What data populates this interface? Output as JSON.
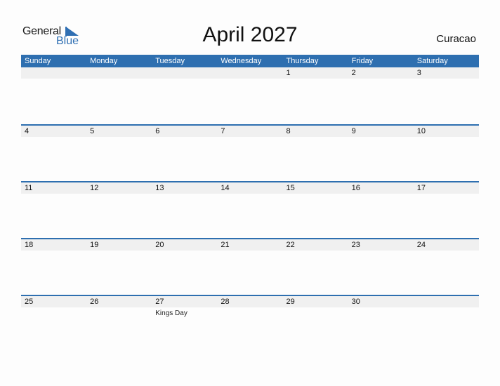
{
  "logo": {
    "line1": "General",
    "line2": "Blue"
  },
  "title": "April 2027",
  "country": "Curacao",
  "colors": {
    "accent": "#2e6fb0",
    "band": "#f0f0f0"
  },
  "weekdays": [
    "Sunday",
    "Monday",
    "Tuesday",
    "Wednesday",
    "Thursday",
    "Friday",
    "Saturday"
  ],
  "weeks": [
    {
      "days": [
        "",
        "",
        "",
        "",
        "1",
        "2",
        "3"
      ],
      "holidays": [
        "",
        "",
        "",
        "",
        "",
        "",
        ""
      ]
    },
    {
      "days": [
        "4",
        "5",
        "6",
        "7",
        "8",
        "9",
        "10"
      ],
      "holidays": [
        "",
        "",
        "",
        "",
        "",
        "",
        ""
      ]
    },
    {
      "days": [
        "11",
        "12",
        "13",
        "14",
        "15",
        "16",
        "17"
      ],
      "holidays": [
        "",
        "",
        "",
        "",
        "",
        "",
        ""
      ]
    },
    {
      "days": [
        "18",
        "19",
        "20",
        "21",
        "22",
        "23",
        "24"
      ],
      "holidays": [
        "",
        "",
        "",
        "",
        "",
        "",
        ""
      ]
    },
    {
      "days": [
        "25",
        "26",
        "27",
        "28",
        "29",
        "30",
        ""
      ],
      "holidays": [
        "",
        "",
        "Kings Day",
        "",
        "",
        "",
        ""
      ]
    }
  ]
}
